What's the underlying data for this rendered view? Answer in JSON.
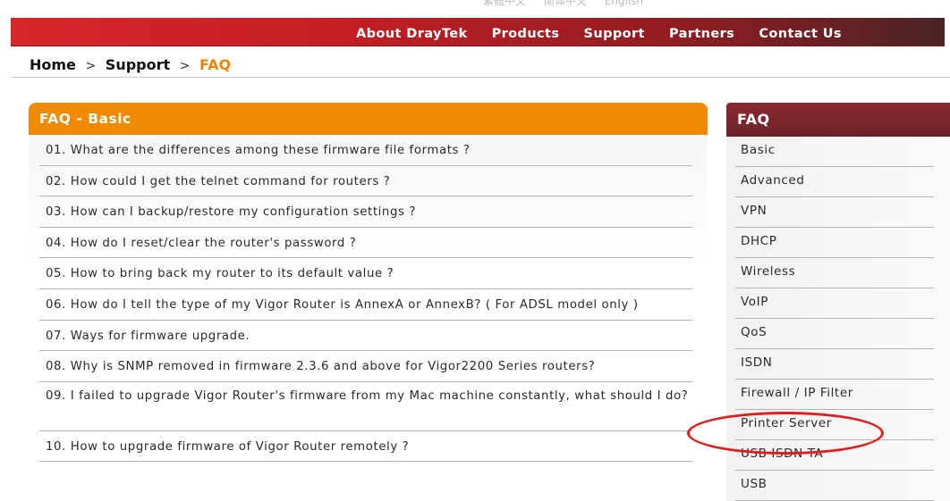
{
  "lang_bar": [
    "繁體中文",
    "简体中文",
    "English"
  ],
  "nav": [
    "About DrayTek",
    "Products",
    "Support",
    "Partners",
    "Contact Us"
  ],
  "breadcrumb": {
    "home": "Home",
    "sep": ">",
    "support": "Support",
    "current": "FAQ"
  },
  "faq_panel": {
    "title": "FAQ - Basic",
    "items": [
      "01. What are the differences among these firmware file formats ?",
      "02. How could I get the telnet command for routers ?",
      "03. How can I backup/restore my configuration settings ?",
      "04. How do I reset/clear the router's password ?",
      "05. How to bring back my router to its default value ?",
      "06. How do I tell the type of my Vigor Router is AnnexA or AnnexB? ( For ADSL model only )",
      "07. Ways for firmware upgrade.",
      "08. Why is SNMP removed in firmware 2.3.6 and above for Vigor2200 Series routers?",
      "09. I failed to upgrade Vigor Router's firmware from my Mac machine constantly, what should I do?",
      "10. How to upgrade firmware of Vigor Router remotely ?"
    ]
  },
  "sidebar": {
    "title": "FAQ",
    "items": [
      "Basic",
      "Advanced",
      "VPN",
      "DHCP",
      "Wireless",
      "VoIP",
      "QoS",
      "ISDN",
      "Firewall / IP Filter",
      "Printer Server",
      "USB ISDN TA",
      "USB"
    ]
  },
  "colors": {
    "nav_red": "#d8262a",
    "faq_orange": "#f08a00",
    "side_maroon": "#7a2730",
    "highlight": "#e31b1b"
  }
}
